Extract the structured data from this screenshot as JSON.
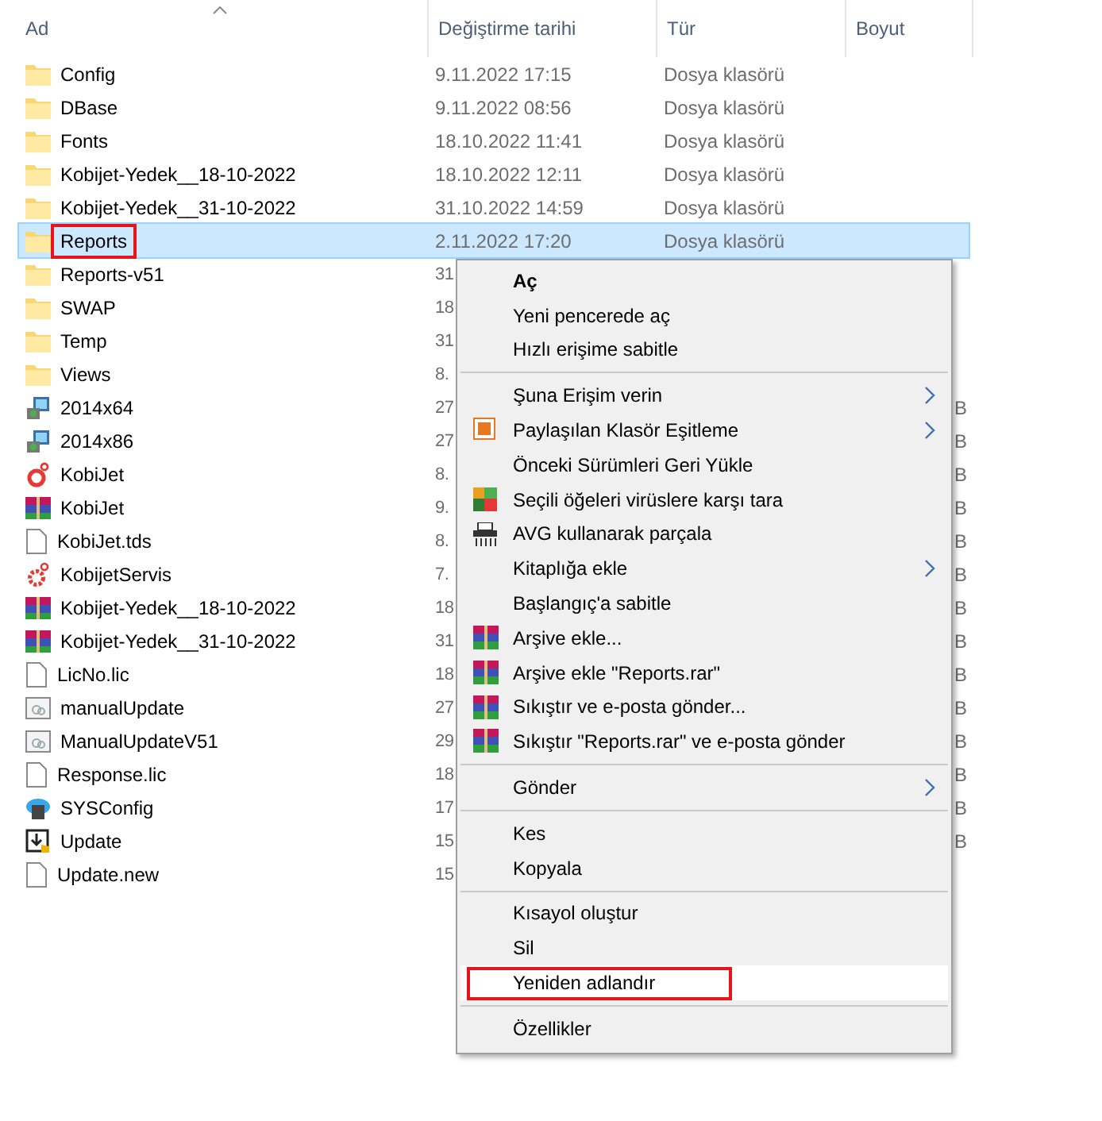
{
  "columns": [
    {
      "label": "Ad",
      "sorted": true
    },
    {
      "label": "Değiştirme tarihi",
      "sorted": false
    },
    {
      "label": "Tür",
      "sorted": false
    },
    {
      "label": "Boyut",
      "sorted": false
    }
  ],
  "rows": [
    {
      "name": "Config",
      "kind": "folder",
      "date": "9.11.2022 17:15",
      "type": "Dosya klasörü",
      "selected": false,
      "annotated": false
    },
    {
      "name": "DBase",
      "kind": "folder",
      "date": "9.11.2022 08:56",
      "type": "Dosya klasörü",
      "selected": false,
      "annotated": false
    },
    {
      "name": "Fonts",
      "kind": "folder",
      "date": "18.10.2022 11:41",
      "type": "Dosya klasörü",
      "selected": false,
      "annotated": false
    },
    {
      "name": "Kobijet-Yedek__18-10-2022",
      "kind": "folder",
      "date": "18.10.2022 12:11",
      "type": "Dosya klasörü",
      "selected": false,
      "annotated": false
    },
    {
      "name": "Kobijet-Yedek__31-10-2022",
      "kind": "folder",
      "date": "31.10.2022 14:59",
      "type": "Dosya klasörü",
      "selected": false,
      "annotated": false
    },
    {
      "name": "Reports",
      "kind": "folder",
      "date": "2.11.2022 17:20",
      "type": "Dosya klasörü",
      "selected": true,
      "annotated": true
    },
    {
      "name": "Reports-v51",
      "kind": "folder",
      "date": "31",
      "selected": false,
      "annotated": false
    },
    {
      "name": "SWAP",
      "kind": "folder",
      "date": "18",
      "selected": false,
      "annotated": false
    },
    {
      "name": "Temp",
      "kind": "folder",
      "date": "31",
      "selected": false,
      "annotated": false
    },
    {
      "name": "Views",
      "kind": "folder",
      "date": "8.",
      "selected": false,
      "annotated": false
    },
    {
      "name": "2014x64",
      "kind": "setup",
      "date": "27",
      "size": "B",
      "selected": false,
      "annotated": false
    },
    {
      "name": "2014x86",
      "kind": "setup",
      "date": "27",
      "size": "B",
      "selected": false,
      "annotated": false
    },
    {
      "name": "KobiJet",
      "kind": "app",
      "date": "8.",
      "size": "B",
      "selected": false,
      "annotated": false
    },
    {
      "name": "KobiJet",
      "kind": "archive",
      "date": "9.",
      "size": "B",
      "selected": false,
      "annotated": false
    },
    {
      "name": "KobiJet.tds",
      "kind": "file",
      "date": "8.",
      "size": "B",
      "selected": false,
      "annotated": false
    },
    {
      "name": "KobijetServis",
      "kind": "service",
      "date": "7.",
      "size": "B",
      "selected": false,
      "annotated": false
    },
    {
      "name": "Kobijet-Yedek__18-10-2022",
      "kind": "archive",
      "date": "18",
      "size": "B",
      "selected": false,
      "annotated": false
    },
    {
      "name": "Kobijet-Yedek__31-10-2022",
      "kind": "archive",
      "date": "31",
      "size": "B",
      "selected": false,
      "annotated": false
    },
    {
      "name": "LicNo.lic",
      "kind": "file",
      "date": "18",
      "size": "B",
      "selected": false,
      "annotated": false
    },
    {
      "name": "manualUpdate",
      "kind": "window",
      "date": "27",
      "size": "B",
      "selected": false,
      "annotated": false
    },
    {
      "name": "ManualUpdateV51",
      "kind": "window",
      "date": "29",
      "size": "B",
      "selected": false,
      "annotated": false
    },
    {
      "name": "Response.lic",
      "kind": "file",
      "date": "18",
      "size": "B",
      "selected": false,
      "annotated": false
    },
    {
      "name": "SYSConfig",
      "kind": "cloud",
      "date": "17",
      "size": "B",
      "selected": false,
      "annotated": false
    },
    {
      "name": "Update",
      "kind": "update",
      "date": "15",
      "size": "B",
      "selected": false,
      "annotated": false
    },
    {
      "name": "Update.new",
      "kind": "file",
      "date": "15",
      "selected": false,
      "annotated": false
    }
  ],
  "context_menu": [
    {
      "kind": "plain",
      "label": "Aç",
      "bold": true
    },
    {
      "kind": "plain",
      "label": "Yeni pencerede aç"
    },
    {
      "kind": "plain",
      "label": "Hızlı erişime sabitle"
    },
    {
      "kind": "separator"
    },
    {
      "kind": "plain",
      "label": "Şuna Erişim verin",
      "submenu": true
    },
    {
      "kind": "sync",
      "label": "Paylaşılan Klasör Eşitleme",
      "submenu": true
    },
    {
      "kind": "plain",
      "label": "Önceki Sürümleri Geri Yükle"
    },
    {
      "kind": "antivirus",
      "label": "Seçili öğeleri virüslere karşı tara"
    },
    {
      "kind": "shredder",
      "label": "AVG kullanarak parçala"
    },
    {
      "kind": "plain",
      "label": "Kitaplığa ekle",
      "submenu": true
    },
    {
      "kind": "plain",
      "label": "Başlangıç'a sabitle"
    },
    {
      "kind": "archive",
      "label": "Arşive ekle..."
    },
    {
      "kind": "archive",
      "label": "Arşive ekle \"Reports.rar\""
    },
    {
      "kind": "archive",
      "label": "Sıkıştır ve e-posta gönder..."
    },
    {
      "kind": "archive",
      "label": "Sıkıştır \"Reports.rar\" ve e-posta gönder"
    },
    {
      "kind": "separator"
    },
    {
      "kind": "plain",
      "label": "Gönder",
      "submenu": true
    },
    {
      "kind": "separator"
    },
    {
      "kind": "plain",
      "label": "Kes"
    },
    {
      "kind": "plain",
      "label": "Kopyala"
    },
    {
      "kind": "separator"
    },
    {
      "kind": "plain",
      "label": "Kısayol oluştur"
    },
    {
      "kind": "plain",
      "label": "Sil"
    },
    {
      "kind": "plain",
      "label": "Yeniden adlandır",
      "hovered": true,
      "annotated": true
    },
    {
      "kind": "separator"
    },
    {
      "kind": "plain",
      "label": "Özellikler"
    }
  ]
}
